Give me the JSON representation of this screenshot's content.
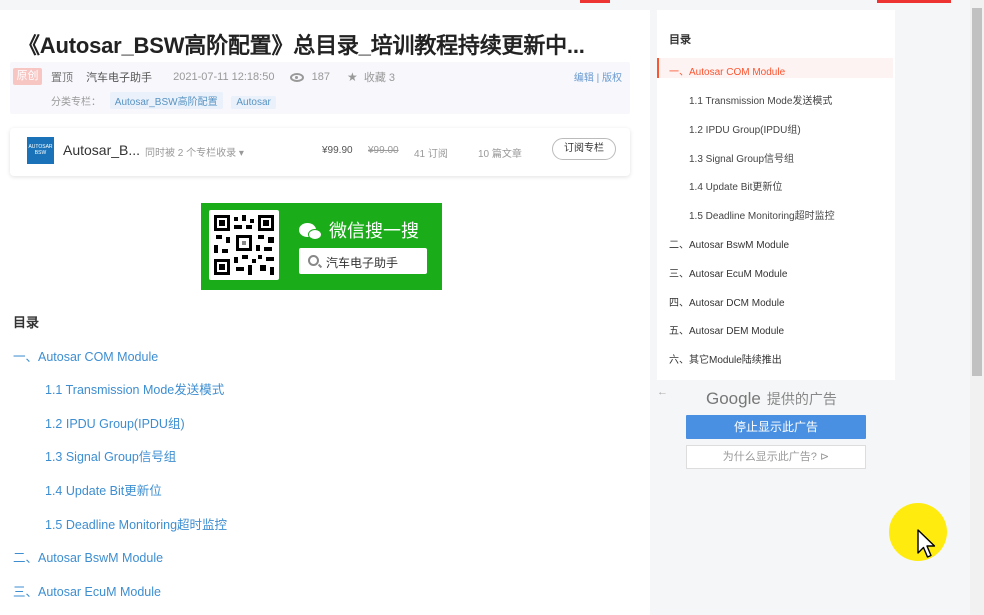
{
  "article": {
    "title": "《Autosar_BSW高阶配置》总目录_培训教程持续更新中...",
    "original_badge": "原创",
    "pin": "置顶",
    "author": "汽车电子助手",
    "datetime": "2021-07-11 12:18:50",
    "views": "187",
    "favorites": "收藏 3",
    "edit_links": "编辑 | 版权",
    "category_label": "分类专栏：",
    "tags": [
      "Autosar_BSW高阶配置",
      "Autosar"
    ]
  },
  "column": {
    "name": "Autosar_B...",
    "shared": "同时被 2 个专栏收录 ▾",
    "price": "¥99.90",
    "old_price": "¥99.00",
    "subscribers": "41 订阅",
    "articles": "10 篇文章",
    "subscribe_button": "订阅专栏",
    "logo_text": "AUTOSAR BSW"
  },
  "wechat": {
    "title": "微信搜一搜",
    "search_text": "汽车电子助手"
  },
  "toc": {
    "heading": "目录",
    "items": [
      {
        "label": "一、Autosar COM Module",
        "level": 1
      },
      {
        "label": "1.1 Transmission Mode发送模式",
        "level": 2
      },
      {
        "label": "1.2 IPDU Group(IPDU组)",
        "level": 2
      },
      {
        "label": "1.3 Signal Group信号组",
        "level": 2
      },
      {
        "label": "1.4 Update Bit更新位",
        "level": 2
      },
      {
        "label": "1.5 Deadline Monitoring超时监控",
        "level": 2
      },
      {
        "label": "二、Autosar BswM Module",
        "level": 1
      },
      {
        "label": "三、Autosar EcuM Module",
        "level": 1
      }
    ]
  },
  "sidebar_toc": {
    "title": "目录",
    "items": [
      {
        "label": "一、Autosar COM Module",
        "level": 1,
        "active": true
      },
      {
        "label": "1.1 Transmission Mode发送模式",
        "level": 2
      },
      {
        "label": "1.2 IPDU Group(IPDU组)",
        "level": 2
      },
      {
        "label": "1.3 Signal Group信号组",
        "level": 2
      },
      {
        "label": "1.4 Update Bit更新位",
        "level": 2
      },
      {
        "label": "1.5 Deadline Monitoring超时监控",
        "level": 2
      },
      {
        "label": "二、Autosar BswM Module",
        "level": 1
      },
      {
        "label": "三、Autosar EcuM Module",
        "level": 1
      },
      {
        "label": "四、Autosar DCM Module",
        "level": 1
      },
      {
        "label": "五、Autosar DEM Module",
        "level": 1
      },
      {
        "label": "六、其它Module陆续推出",
        "level": 1
      }
    ]
  },
  "ad": {
    "back_arrow": "←",
    "google": "Google",
    "provided": "提供的广告",
    "stop_button": "停止显示此广告",
    "why_button": "为什么显示此广告?",
    "why_icon": "⊳"
  },
  "colors": {
    "link": "#3d8ed1",
    "accent": "#fc5531",
    "wechat_green": "#1aad19",
    "ad_blue": "#4a90e2",
    "cursor_highlight": "#ffea00"
  }
}
